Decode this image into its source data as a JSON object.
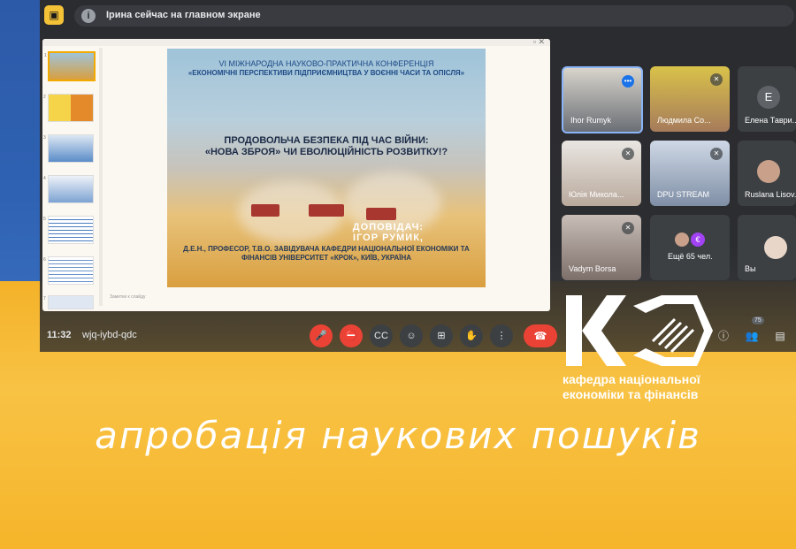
{
  "topbar": {
    "message": "Ірина сейчас на главном экране"
  },
  "slide": {
    "conf_line1": "VI  МІЖНАРОДНА НАУКОВО-ПРАКТИЧНА КОНФЕРЕНЦІЯ",
    "conf_line2": "«ЕКОНОМІЧНІ ПЕРСПЕКТИВИ ПІДПРИЄМНИЦТВА У ВОЄННІ ЧАСИ ТА ОПІСЛЯ»",
    "title_line1": "ПРОДОВОЛЬЧА БЕЗПЕКА ПІД ЧАС ВІЙНИ:",
    "title_line2": "«НОВА ЗБРОЯ» ЧИ ЕВОЛЮЦІЙНІСТЬ РОЗВИТКУ!?",
    "speaker_label": "ДОПОВІДАЧ:",
    "speaker_name": "ІГОР РУМИК,",
    "speaker_info": "Д.Е.Н., ПРОФЕСОР, Т.В.О. ЗАВІДУВАЧА КАФЕДРИ НАЦІОНАЛЬНОЇ ЕКОНОМІКИ ТА ФІНАНСІВ УНІВЕРСИТЕТ «КРОК», КИЇВ, УКРАЇНА",
    "notes_placeholder": "Заметки к слайду"
  },
  "thumb_numbers": [
    "1",
    "2",
    "3",
    "4",
    "5",
    "6",
    "7"
  ],
  "participants": [
    {
      "name": "Ihor Rumyk"
    },
    {
      "name": "Людмила Со..."
    },
    {
      "name": "Елена Таври..."
    },
    {
      "name": "Юлія Микола..."
    },
    {
      "name": "DPU STREAM"
    },
    {
      "name": "Ruslana Lisov..."
    },
    {
      "name": "Vadym Borsa"
    },
    {
      "name": "Ещё 65 чел."
    },
    {
      "name": "Вы"
    }
  ],
  "avatar_letter": "E",
  "controls": {
    "time": "11:32",
    "meeting_id": "wjq-iybd-qdc",
    "people_count": "75"
  },
  "logo": {
    "line1": "кафедра національної",
    "line2": "економіки та фінансів"
  },
  "tagline": "апробація наукових пошуків",
  "colors": {
    "ukraine_blue": "#2f62b3",
    "ukraine_yellow": "#f6b52a",
    "end_call_red": "#ea4335"
  }
}
